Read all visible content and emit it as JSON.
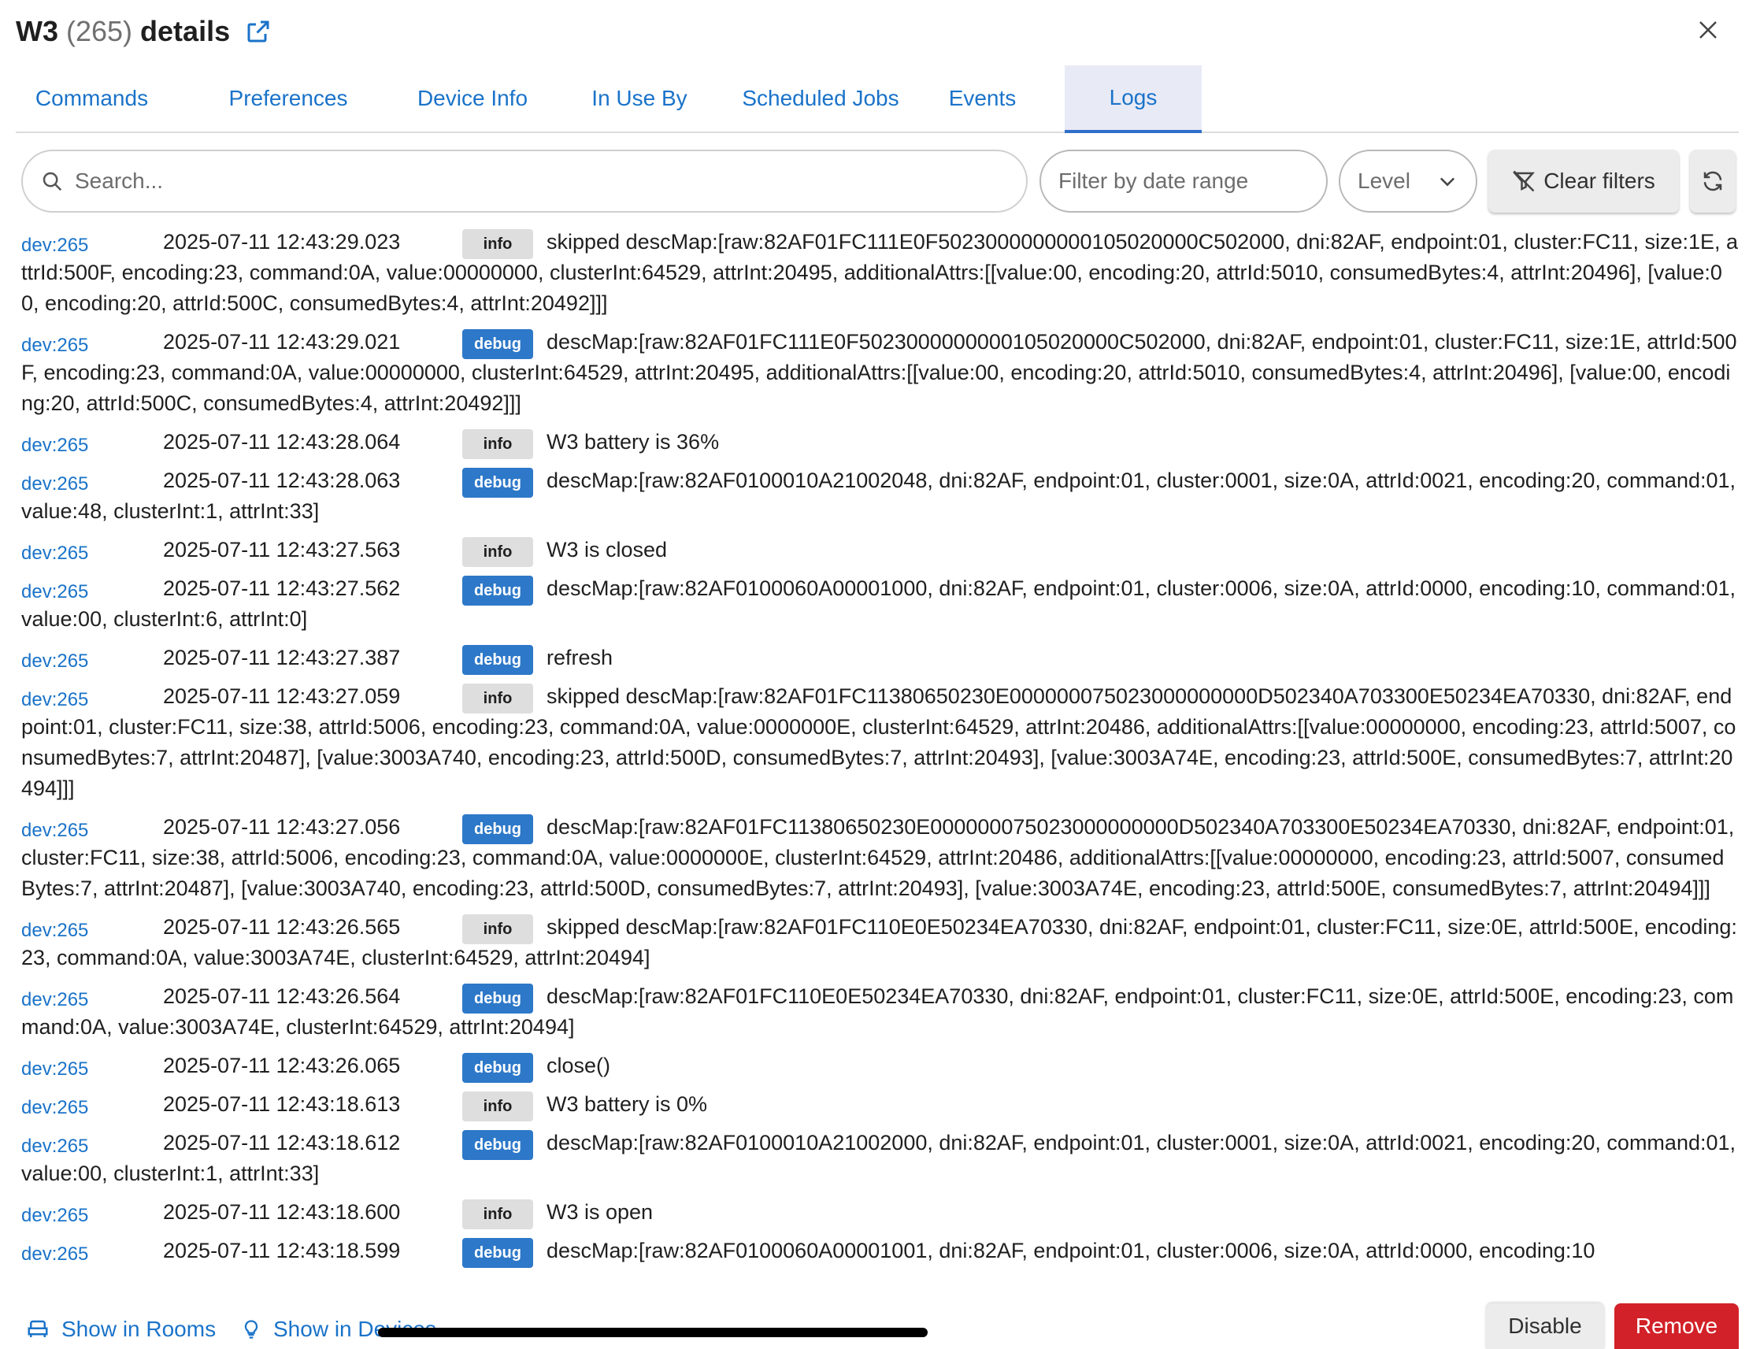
{
  "header": {
    "name": "W3",
    "count": "(265)",
    "suffix": "details"
  },
  "tabs": [
    {
      "label": "Commands"
    },
    {
      "label": "Preferences"
    },
    {
      "label": "Device Info"
    },
    {
      "label": "In Use By"
    },
    {
      "label": "Scheduled Jobs"
    },
    {
      "label": "Events"
    },
    {
      "label": "Logs",
      "active": true
    }
  ],
  "filters": {
    "search_placeholder": "Search...",
    "date_placeholder": "Filter by date range",
    "level_label": "Level",
    "clear_label": "Clear filters"
  },
  "logs": [
    {
      "dev": "dev:265",
      "ts": "2025-07-11 12:43:29.023",
      "level": "info",
      "msg": "skipped descMap:[raw:82AF01FC111E0F5023000000000105020000C502000, dni:82AF, endpoint:01, cluster:FC11, size:1E, attrId:500F, encoding:23, command:0A, value:00000000, clusterInt:64529, attrInt:20495, additionalAttrs:[[value:00, encoding:20, attrId:5010, consumedBytes:4, attrInt:20496], [value:00, encoding:20, attrId:500C, consumedBytes:4, attrInt:20492]]]"
    },
    {
      "dev": "dev:265",
      "ts": "2025-07-11 12:43:29.021",
      "level": "debug",
      "msg": "descMap:[raw:82AF01FC111E0F5023000000000105020000C502000, dni:82AF, endpoint:01, cluster:FC11, size:1E, attrId:500F, encoding:23, command:0A, value:00000000, clusterInt:64529, attrInt:20495, additionalAttrs:[[value:00, encoding:20, attrId:5010, consumedBytes:4, attrInt:20496], [value:00, encoding:20, attrId:500C, consumedBytes:4, attrInt:20492]]]"
    },
    {
      "dev": "dev:265",
      "ts": "2025-07-11 12:43:28.064",
      "level": "info",
      "msg": "W3 battery is 36%"
    },
    {
      "dev": "dev:265",
      "ts": "2025-07-11 12:43:28.063",
      "level": "debug",
      "msg": "descMap:[raw:82AF0100010A21002048, dni:82AF, endpoint:01, cluster:0001, size:0A, attrId:0021, encoding:20, command:01, value:48, clusterInt:1, attrInt:33]"
    },
    {
      "dev": "dev:265",
      "ts": "2025-07-11 12:43:27.563",
      "level": "info",
      "msg": "W3 is closed"
    },
    {
      "dev": "dev:265",
      "ts": "2025-07-11 12:43:27.562",
      "level": "debug",
      "msg": "descMap:[raw:82AF0100060A00001000, dni:82AF, endpoint:01, cluster:0006, size:0A, attrId:0000, encoding:10, command:01, value:00, clusterInt:6, attrInt:0]"
    },
    {
      "dev": "dev:265",
      "ts": "2025-07-11 12:43:27.387",
      "level": "debug",
      "msg": "refresh"
    },
    {
      "dev": "dev:265",
      "ts": "2025-07-11 12:43:27.059",
      "level": "info",
      "msg": "skipped descMap:[raw:82AF01FC11380650230E000000075023000000000D502340A703300E50234EA70330, dni:82AF, endpoint:01, cluster:FC11, size:38, attrId:5006, encoding:23, command:0A, value:0000000E, clusterInt:64529, attrInt:20486, additionalAttrs:[[value:00000000, encoding:23, attrId:5007, consumedBytes:7, attrInt:20487], [value:3003A740, encoding:23, attrId:500D, consumedBytes:7, attrInt:20493], [value:3003A74E, encoding:23, attrId:500E, consumedBytes:7, attrInt:20494]]]"
    },
    {
      "dev": "dev:265",
      "ts": "2025-07-11 12:43:27.056",
      "level": "debug",
      "msg": "descMap:[raw:82AF01FC11380650230E000000075023000000000D502340A703300E50234EA70330, dni:82AF, endpoint:01, cluster:FC11, size:38, attrId:5006, encoding:23, command:0A, value:0000000E, clusterInt:64529, attrInt:20486, additionalAttrs:[[value:00000000, encoding:23, attrId:5007, consumedBytes:7, attrInt:20487], [value:3003A740, encoding:23, attrId:500D, consumedBytes:7, attrInt:20493], [value:3003A74E, encoding:23, attrId:500E, consumedBytes:7, attrInt:20494]]]"
    },
    {
      "dev": "dev:265",
      "ts": "2025-07-11 12:43:26.565",
      "level": "info",
      "msg": "skipped descMap:[raw:82AF01FC110E0E50234EA70330, dni:82AF, endpoint:01, cluster:FC11, size:0E, attrId:500E, encoding:23, command:0A, value:3003A74E, clusterInt:64529, attrInt:20494]"
    },
    {
      "dev": "dev:265",
      "ts": "2025-07-11 12:43:26.564",
      "level": "debug",
      "msg": "descMap:[raw:82AF01FC110E0E50234EA70330, dni:82AF, endpoint:01, cluster:FC11, size:0E, attrId:500E, encoding:23, command:0A, value:3003A74E, clusterInt:64529, attrInt:20494]"
    },
    {
      "dev": "dev:265",
      "ts": "2025-07-11 12:43:26.065",
      "level": "debug",
      "msg": "close()"
    },
    {
      "dev": "dev:265",
      "ts": "2025-07-11 12:43:18.613",
      "level": "info",
      "msg": "W3 battery is 0%"
    },
    {
      "dev": "dev:265",
      "ts": "2025-07-11 12:43:18.612",
      "level": "debug",
      "msg": "descMap:[raw:82AF0100010A21002000, dni:82AF, endpoint:01, cluster:0001, size:0A, attrId:0021, encoding:20, command:01, value:00, clusterInt:1, attrInt:33]"
    },
    {
      "dev": "dev:265",
      "ts": "2025-07-11 12:43:18.600",
      "level": "info",
      "msg": "W3 is open"
    },
    {
      "dev": "dev:265",
      "ts": "2025-07-11 12:43:18.599",
      "level": "debug",
      "msg": "descMap:[raw:82AF0100060A00001001, dni:82AF, endpoint:01, cluster:0006, size:0A, attrId:0000, encoding:10"
    }
  ],
  "footer": {
    "rooms_label": "Show in Rooms",
    "devices_label": "Show in Devices",
    "disable_label": "Disable",
    "remove_label": "Remove"
  },
  "colors": {
    "accent": "#1a73c9",
    "debug_badge": "#2d78c8",
    "info_badge": "#dedede",
    "remove": "#d22128"
  }
}
